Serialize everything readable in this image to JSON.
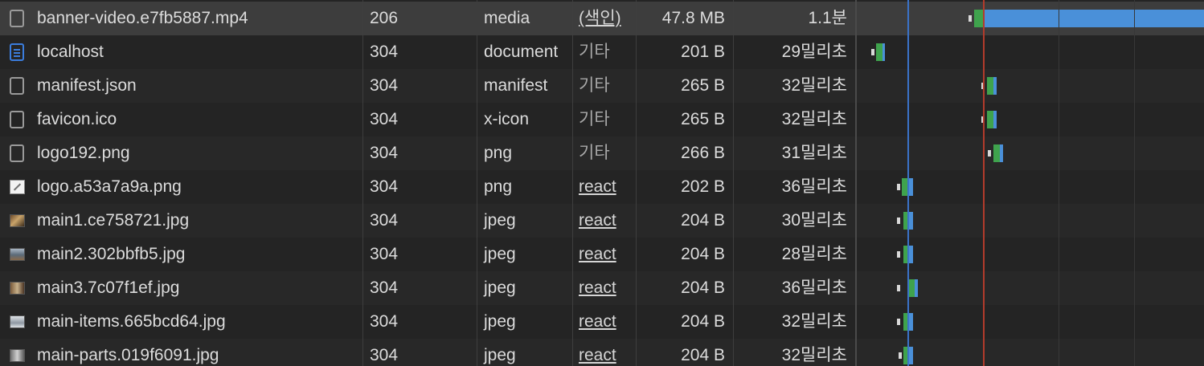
{
  "network": {
    "rows": [
      {
        "name": "banner-video.e7fb5887.mp4",
        "status": "206",
        "type": "media",
        "initiator": "(색인)",
        "size": "47.8 MB",
        "time": "1.1분",
        "icon": "file-icon",
        "initiator_link": true,
        "selected": true
      },
      {
        "name": "localhost",
        "status": "304",
        "type": "document",
        "initiator": "기타",
        "size": "201 B",
        "time": "29밀리초",
        "icon": "document-icon",
        "initiator_link": false
      },
      {
        "name": "manifest.json",
        "status": "304",
        "type": "manifest",
        "initiator": "기타",
        "size": "265 B",
        "time": "32밀리초",
        "icon": "file-icon",
        "initiator_link": false
      },
      {
        "name": "favicon.ico",
        "status": "304",
        "type": "x-icon",
        "initiator": "기타",
        "size": "265 B",
        "time": "32밀리초",
        "icon": "file-icon",
        "initiator_link": false
      },
      {
        "name": "logo192.png",
        "status": "304",
        "type": "png",
        "initiator": "기타",
        "size": "266 B",
        "time": "31밀리초",
        "icon": "file-icon",
        "initiator_link": false
      },
      {
        "name": "logo.a53a7a9a.png",
        "status": "304",
        "type": "png",
        "initiator": "react",
        "size": "202 B",
        "time": "36밀리초",
        "icon": "image-icon",
        "initiator_link": true
      },
      {
        "name": "main1.ce758721.jpg",
        "status": "304",
        "type": "jpeg",
        "initiator": "react",
        "size": "204 B",
        "time": "30밀리초",
        "icon": "thumbnail-icon",
        "initiator_link": true
      },
      {
        "name": "main2.302bbfb5.jpg",
        "status": "304",
        "type": "jpeg",
        "initiator": "react",
        "size": "204 B",
        "time": "28밀리초",
        "icon": "thumbnail-icon",
        "initiator_link": true
      },
      {
        "name": "main3.7c07f1ef.jpg",
        "status": "304",
        "type": "jpeg",
        "initiator": "react",
        "size": "204 B",
        "time": "36밀리초",
        "icon": "thumbnail-icon",
        "initiator_link": true
      },
      {
        "name": "main-items.665bcd64.jpg",
        "status": "304",
        "type": "jpeg",
        "initiator": "react",
        "size": "204 B",
        "time": "32밀리초",
        "icon": "thumbnail-icon",
        "initiator_link": true
      },
      {
        "name": "main-parts.019f6091.jpg",
        "status": "304",
        "type": "jpeg",
        "initiator": "react",
        "size": "204 B",
        "time": "32밀리초",
        "icon": "thumbnail-icon",
        "initiator_link": true
      }
    ]
  },
  "colors": {
    "waiting": "#3fa34d",
    "download": "#4a90d9",
    "dom_content_loaded_line": "#3a72c8",
    "load_line": "#b23b2b",
    "selected_row": "#3d3d3d"
  }
}
